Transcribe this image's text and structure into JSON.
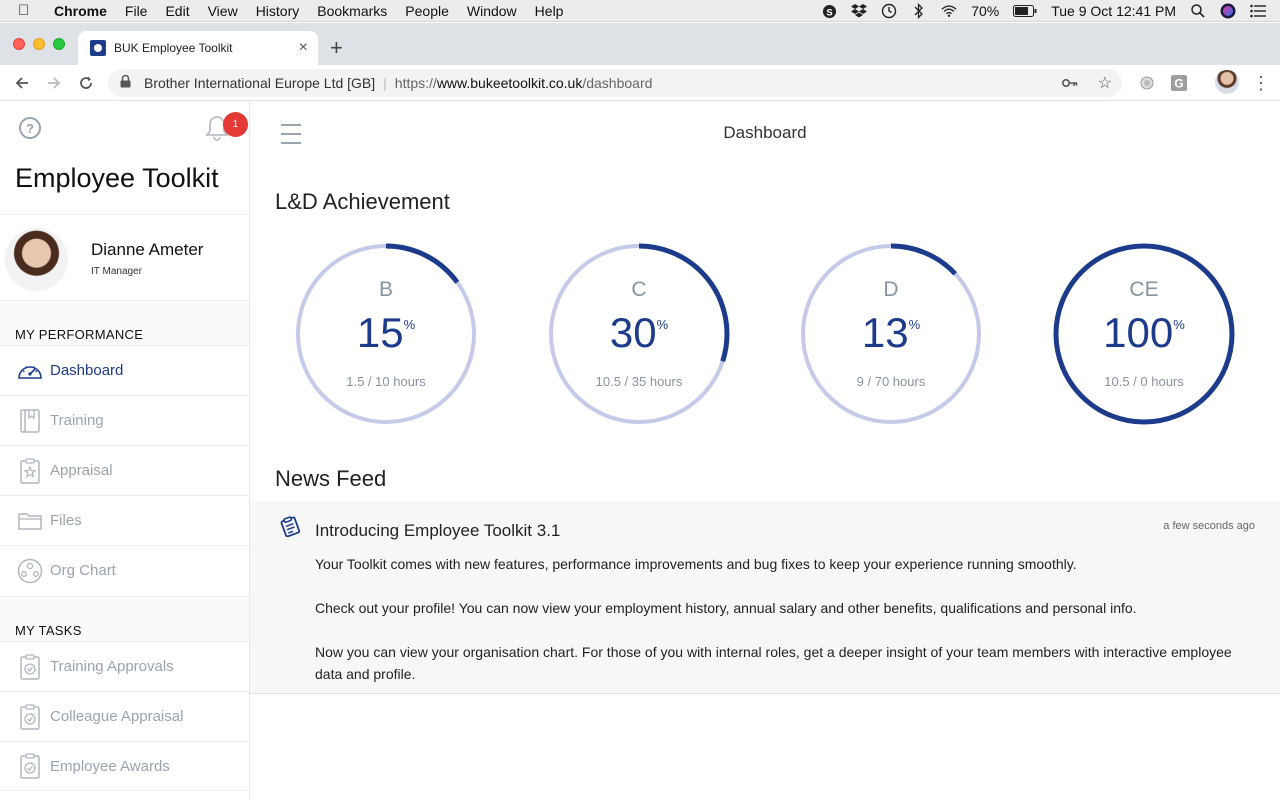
{
  "menubar": {
    "app": "Chrome",
    "items": [
      "File",
      "Edit",
      "View",
      "History",
      "Bookmarks",
      "People",
      "Window",
      "Help"
    ],
    "battery": "70%",
    "clock": "Tue 9 Oct  12:41 PM"
  },
  "browser": {
    "tab_title": "BUK Employee Toolkit",
    "site_org": "Brother International Europe Ltd [GB]",
    "url_scheme": "https://",
    "url_domain": "www.bukeetoolkit.co.uk",
    "url_path": "/dashboard"
  },
  "sidebar": {
    "notification_count": "1",
    "app_title": "Employee Toolkit",
    "user": {
      "name": "Dianne Ameter",
      "role": "IT Manager"
    },
    "performance_title": "MY PERFORMANCE",
    "performance_items": [
      {
        "label": "Dashboard",
        "icon": "gauge-icon",
        "active": true
      },
      {
        "label": "Training",
        "icon": "book-icon",
        "active": false
      },
      {
        "label": "Appraisal",
        "icon": "clipboard-star-icon",
        "active": false
      },
      {
        "label": "Files",
        "icon": "folder-icon",
        "active": false
      },
      {
        "label": "Org Chart",
        "icon": "org-chart-icon",
        "active": false
      }
    ],
    "tasks_title": "MY TASKS",
    "task_items": [
      {
        "label": "Training Approvals",
        "icon": "clipboard-check-icon"
      },
      {
        "label": "Colleague Appraisal",
        "icon": "clipboard-check-icon"
      },
      {
        "label": "Employee Awards",
        "icon": "clipboard-check-icon"
      }
    ]
  },
  "main": {
    "page_title": "Dashboard",
    "achievement_title": "L&D Achievement",
    "achievements": [
      {
        "letter": "B",
        "percent": 15,
        "pct_label": "15",
        "hours": "1.5 / 10 hours"
      },
      {
        "letter": "C",
        "percent": 30,
        "pct_label": "30",
        "hours": "10.5 / 35 hours"
      },
      {
        "letter": "D",
        "percent": 13,
        "pct_label": "13",
        "hours": "9 / 70 hours"
      },
      {
        "letter": "CE",
        "percent": 100,
        "pct_label": "100",
        "hours": "10.5 / 0 hours"
      }
    ],
    "percent_sign": "%",
    "news_title": "News Feed",
    "news": {
      "title": "Introducing Employee Toolkit 3.1",
      "time": "a few seconds ago",
      "paragraphs": [
        "Your Toolkit comes with new features, performance improvements and bug fixes to keep your experience running smoothly.",
        "Check out your profile! You can now view your employment history, annual salary and other benefits, qualifications and personal info.",
        "Now you can view your organisation chart. For those of you with internal roles, get a deeper insight of your team members with interactive employee data and profile."
      ]
    }
  },
  "colors": {
    "brand": "#1d3b8b",
    "ring_track": "#c5cae9",
    "muted": "#9aa4b0",
    "badge": "#e53935"
  }
}
